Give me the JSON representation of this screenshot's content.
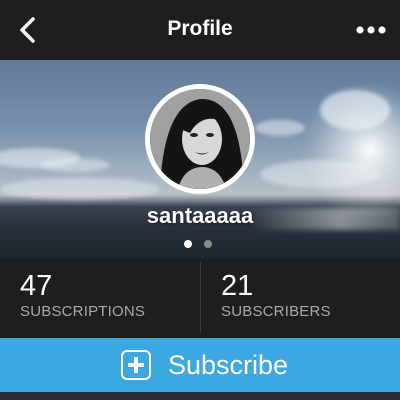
{
  "nav": {
    "title": "Profile",
    "back_icon": "chevron-left-icon",
    "more_icon": "more-horizontal-icon"
  },
  "profile": {
    "username": "santaaaaa",
    "page_indicator": {
      "count": 2,
      "active_index": 0
    }
  },
  "stats": {
    "subscriptions": {
      "value": "47",
      "label": "SUBSCRIPTIONS"
    },
    "subscribers": {
      "value": "21",
      "label": "SUBSCRIBERS"
    }
  },
  "subscribe": {
    "label": "Subscribe",
    "icon": "plus-square-icon"
  },
  "colors": {
    "nav_bg": "#1e1e1e",
    "accent": "#3ca9e2",
    "label_gray": "#a9a9a9",
    "dot_active": "#ffffff",
    "dot_inactive": "#8a8a8a"
  }
}
